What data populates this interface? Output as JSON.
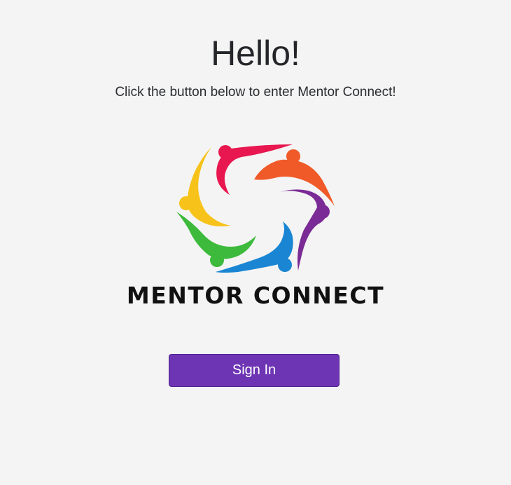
{
  "header": {
    "title": "Hello!",
    "subtitle": "Click the button below to enter Mentor Connect!"
  },
  "logo": {
    "text": "MENTOR CONNECT",
    "figure_colors": [
      "#e8174f",
      "#f05a28",
      "#7b2b95",
      "#1a86d3",
      "#3dba3c",
      "#f7c21a"
    ]
  },
  "actions": {
    "sign_in_label": "Sign In",
    "sign_in_color": "#6d35b4"
  }
}
